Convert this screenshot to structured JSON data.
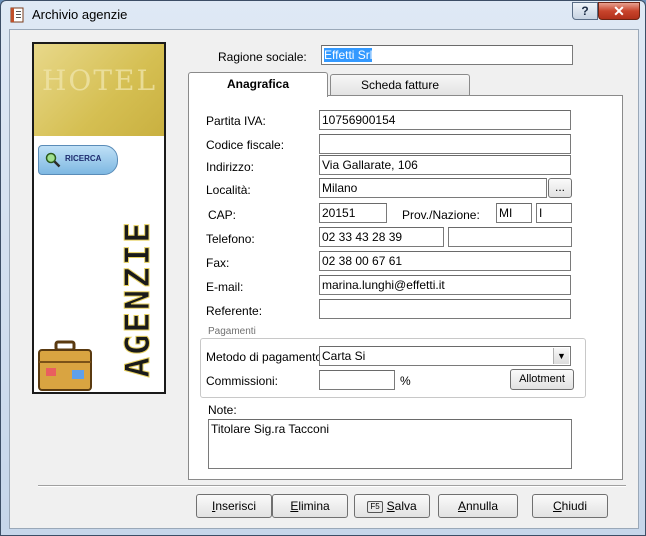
{
  "window": {
    "title": "Archivio agenzie",
    "help_label": "?",
    "close_label": "✕"
  },
  "side_panel": {
    "hotel_text": "HOTEL",
    "search_label": "RICERCA",
    "logo_text": "AGENZIE"
  },
  "ragione_sociale": {
    "label": "Ragione sociale:",
    "value": "Effetti Srl"
  },
  "tabs": [
    {
      "label": "Anagrafica",
      "active": true
    },
    {
      "label": "Scheda fatture",
      "active": false
    }
  ],
  "form": {
    "partita_iva": {
      "label": "Partita IVA:",
      "value": "10756900154"
    },
    "codice_fiscale": {
      "label": "Codice fiscale:",
      "value": ""
    },
    "indirizzo": {
      "label": "Indirizzo:",
      "value": "Via Gallarate, 106"
    },
    "localita": {
      "label": "Località:",
      "value": "Milano",
      "browse_label": "..."
    },
    "cap": {
      "label": "CAP:",
      "value": "20151"
    },
    "prov_nazione": {
      "label": "Prov./Nazione:",
      "prov": "MI",
      "nazione": "I"
    },
    "telefono": {
      "label": "Telefono:",
      "value": "02 33 43 28 39",
      "value2": ""
    },
    "fax": {
      "label": "Fax:",
      "value": "02 38 00 67 61"
    },
    "email": {
      "label": "E-mail:",
      "value": "marina.lunghi@effetti.it"
    },
    "referente": {
      "label": "Referente:",
      "value": ""
    }
  },
  "pagamenti": {
    "group_title": "Pagamenti",
    "metodo_label": "Metodo di pagamento:",
    "metodo_value": "Carta Si",
    "commissioni_label": "Commissioni:",
    "commissioni_value": "",
    "percent": "%",
    "allotment_label": "Allotment"
  },
  "note": {
    "label": "Note:",
    "value": "Titolare Sig.ra Tacconi"
  },
  "buttons": {
    "inserisci": {
      "first": "I",
      "rest": "nserisci"
    },
    "elimina": {
      "first": "E",
      "rest": "limina"
    },
    "salva": {
      "key": "F5",
      "first": "S",
      "rest": "alva"
    },
    "annulla": {
      "first": "A",
      "rest": "nnulla"
    },
    "chiudi": {
      "first": "C",
      "rest": "hiudi"
    }
  }
}
